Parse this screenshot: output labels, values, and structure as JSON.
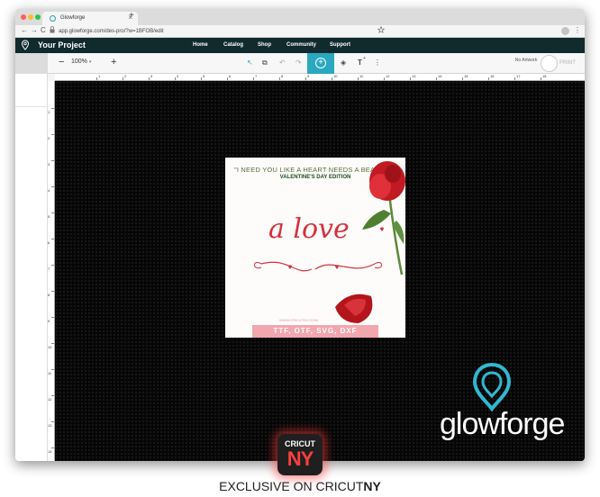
{
  "browser": {
    "tab_title": "Glowforge",
    "tab_close": "×",
    "new_tab": "+",
    "back": "←",
    "forward": "→",
    "reload": "C",
    "url": "app.glowforge.com/des-pro/?w=1BFOB/edit",
    "lock_icon": "lock-icon",
    "star_icon": "star-icon",
    "menu": "⋮"
  },
  "app": {
    "title": "Your Project",
    "nav": [
      "Home",
      "Catalog",
      "Shop",
      "Community",
      "Support"
    ],
    "brand_color": "#102a2e",
    "accent_color": "#2aa8c0"
  },
  "toolbar": {
    "zoom_minus": "−",
    "zoom_value": "100%",
    "zoom_plus": "+",
    "tool_select": "↖",
    "tool_group": "⧉",
    "tool_undo": "↶",
    "tool_redo": "↷",
    "tool_add": "+",
    "tool_shapes": "◈",
    "tool_text": "T",
    "tool_text_mark": "+",
    "tool_more": "⋮",
    "no_artwork": "No Artwork",
    "print_label": "PRINT"
  },
  "rulers": {
    "top": [
      "1",
      "2",
      "3",
      "4",
      "5",
      "6",
      "7",
      "8",
      "9",
      "10",
      "11",
      "12",
      "13",
      "14",
      "15",
      "16",
      "17",
      "18"
    ],
    "left": [
      "1",
      "2",
      "3",
      "4",
      "5",
      "6",
      "7",
      "8",
      "9",
      "10",
      "11",
      "12",
      "13",
      "14"
    ]
  },
  "artwork": {
    "tagline": "\"I NEED YOU LIKE A HEART NEEDS A BEAT\"",
    "edition": "VALENTINE'S DAY EDITION",
    "script": "a love",
    "watermark": "WWW.CRICUTNY.COM",
    "banner": "TTF, OTF, SVG, DXF"
  },
  "overlay": {
    "glowforge_word": "glowforge",
    "cricut_top": "CRICUT",
    "cricut_bottom": "NY",
    "exclusive_prefix": "EXCLUSIVE ON CRICUT",
    "exclusive_suffix": "NY"
  }
}
